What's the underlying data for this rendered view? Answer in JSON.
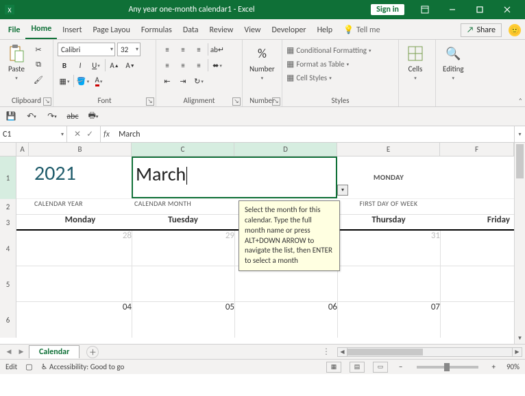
{
  "titlebar": {
    "doc_title": "Any year one-month calendar1  -  Excel",
    "signin": "Sign in"
  },
  "tabs": {
    "file": "File",
    "home": "Home",
    "insert": "Insert",
    "page_layout": "Page Layou",
    "formulas": "Formulas",
    "data": "Data",
    "review": "Review",
    "view": "View",
    "developer": "Developer",
    "help": "Help",
    "tell_me": "Tell me",
    "share": "Share"
  },
  "ribbon": {
    "clipboard": {
      "label": "Clipboard",
      "paste": "Paste"
    },
    "font": {
      "label": "Font",
      "font_name": "Calibri",
      "font_size": "32"
    },
    "alignment": {
      "label": "Alignment"
    },
    "number": {
      "label": "Number",
      "format": "Number"
    },
    "styles": {
      "label": "Styles",
      "cond_fmt": "Conditional Formatting",
      "as_table": "Format as Table",
      "cell_styles": "Cell Styles"
    },
    "cells": {
      "label": "Cells",
      "btn": "Cells"
    },
    "editing": {
      "label": "Editing",
      "btn": "Editing"
    }
  },
  "namebox": {
    "ref": "C1",
    "fx": "fx",
    "formula_value": "March"
  },
  "grid": {
    "col_letters": [
      "A",
      "B",
      "C",
      "D",
      "E",
      "F"
    ],
    "row_numbers": [
      "1",
      "2",
      "3",
      "4",
      "5",
      "6"
    ],
    "year_value": "2021",
    "year_caption": "CALENDAR YEAR",
    "month_value": "March",
    "month_caption": "CALENDAR MONTH",
    "first_day_value": "MONDAY",
    "first_day_caption": "FIRST DAY OF WEEK",
    "day_headers": [
      "Monday",
      "Tuesday",
      "",
      "Thursday",
      "Friday"
    ],
    "row4": [
      "28",
      "29",
      "",
      "31",
      ""
    ],
    "row6": [
      "04",
      "05",
      "06",
      "07",
      ""
    ],
    "tooltip": "Select the month for this calendar. Type the full month name or press ALT+DOWN ARROW to navigate the list, then ENTER to select a month"
  },
  "sheet_tabs": {
    "active": "Calendar"
  },
  "status": {
    "mode": "Edit",
    "accessibility": "Accessibility: Good to go",
    "zoom": "90%"
  }
}
